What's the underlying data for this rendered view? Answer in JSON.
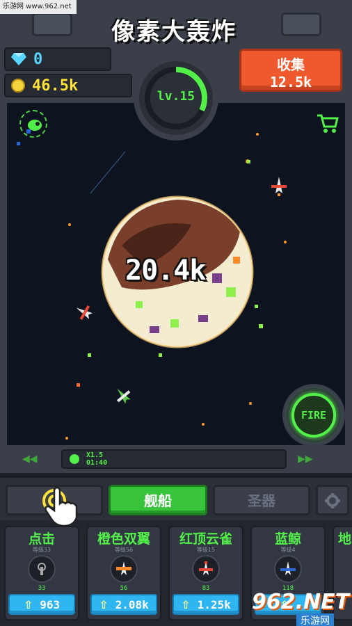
{
  "watermark_top": "乐游网 www.962.net",
  "header": {
    "title": "像素大轰炸",
    "gems": "0",
    "coins": "46.5k",
    "level": "lv.15",
    "level_progress": 0.32,
    "collect_label": "收集",
    "collect_amount": "12.5k"
  },
  "battle": {
    "damage": "20.4k"
  },
  "boost": {
    "multiplier": "X1.5",
    "timer": "01:40"
  },
  "fire_label": "FIRE",
  "tabs": {
    "ships": "舰船",
    "artifacts": "圣器"
  },
  "cards": [
    {
      "name": "点击",
      "level": "等级33",
      "count": "33",
      "price": "963",
      "icon": "tap-icon"
    },
    {
      "name": "橙色双翼",
      "level": "等级56",
      "count": "56",
      "price": "2.08k",
      "icon": "orange-ship-icon"
    },
    {
      "name": "红顶云雀",
      "level": "等级15",
      "count": "83",
      "price": "1.25k",
      "icon": "red-ship-icon"
    },
    {
      "name": "蓝鲸",
      "level": "等级4",
      "count": "118",
      "price": "",
      "icon": "blue-ship-icon"
    },
    {
      "name": "地",
      "level": "",
      "count": "",
      "price": "",
      "icon": ""
    }
  ],
  "watermark_bottom": {
    "logo": "962.NET",
    "sub": "乐游网"
  },
  "colors": {
    "accent_green": "#53f04a",
    "collect_orange": "#ee5a2e",
    "buy_blue": "#2fb5f0",
    "coin_yellow": "#ffe23a",
    "gem_cyan": "#58d6ff"
  }
}
